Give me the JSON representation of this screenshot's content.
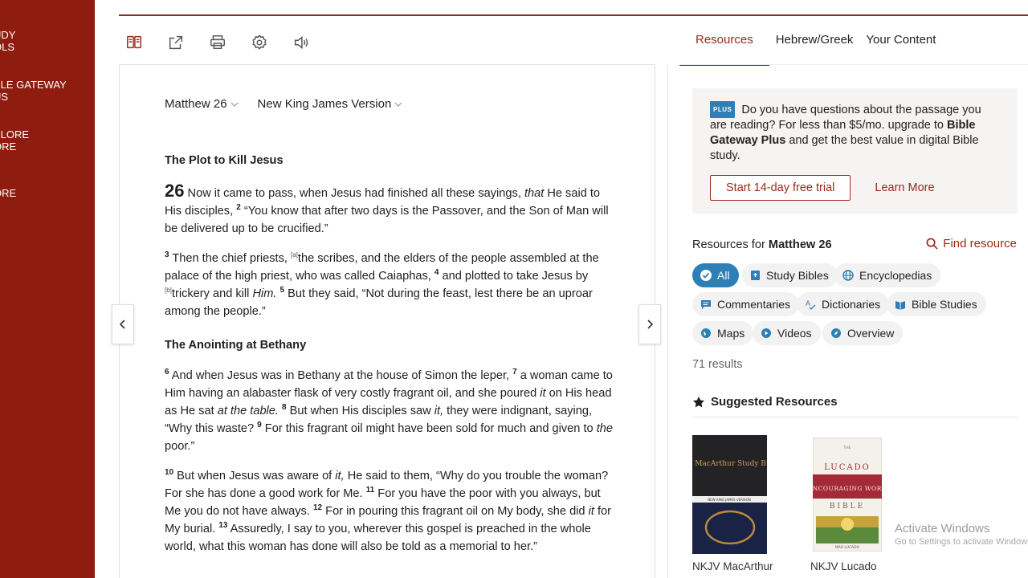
{
  "sidebar": {
    "items": [
      {
        "label": "UDY\nOLS"
      },
      {
        "label": "BLE GATEWAY\nUS"
      },
      {
        "label": "PLORE\nORE"
      },
      {
        "label": "ORE"
      }
    ]
  },
  "toolbar": {
    "icons": [
      "parallel-view-icon",
      "share-icon",
      "print-icon",
      "settings-icon",
      "audio-icon"
    ]
  },
  "tabs": [
    {
      "label": "Resources",
      "active": true
    },
    {
      "label": "Hebrew/Greek",
      "active": false
    },
    {
      "label": "Your Content",
      "active": false
    }
  ],
  "passage": {
    "reference": "Matthew 26",
    "version": "New King James Version"
  },
  "text": {
    "h1": "The Plot to Kill Jesus",
    "p1_chap": "26",
    "p1_a": " Now it came to pass, when Jesus had finished all these sayings, ",
    "p1_b_it": "that",
    "p1_c": " He said to His disciples, ",
    "p1_v2": "2",
    "p1_d": " “You know that after two days is the Passover, and the Son of Man will be delivered up to be crucified.”",
    "p2_v3": "3",
    "p2_a": " Then the chief priests, ",
    "p2_fa": "[a]",
    "p2_b": "the scribes, and the elders of the people assembled at the palace of the high priest, who was called Caiaphas, ",
    "p2_v4": "4",
    "p2_c": " and plotted to take Jesus by ",
    "p2_fb": "[b]",
    "p2_d": "trickery and kill ",
    "p2_e_it": "Him.",
    "p2_v5": "5",
    "p2_f": " But they said, “Not during the feast, lest there be an uproar among the people.”",
    "h2": "The Anointing at Bethany",
    "p3_v6": "6",
    "p3_a": " And when Jesus was in Bethany at the house of Simon the leper, ",
    "p3_v7": "7",
    "p3_b": " a woman came to Him having an alabaster flask of very costly fragrant oil, and she poured ",
    "p3_c_it": "it",
    "p3_d": " on His head as He sat ",
    "p3_e_it": "at the table.",
    "p3_v8": "8",
    "p3_f": " But when His disciples saw ",
    "p3_g_it": "it,",
    "p3_h": " they were indignant, saying, “Why this waste? ",
    "p3_v9": "9",
    "p3_i": " For this fragrant oil might have been sold for much and given to ",
    "p3_j_it": "the",
    "p3_k": " poor.”",
    "p4_v10": "10",
    "p4_a": " But when Jesus was aware of ",
    "p4_b_it": "it,",
    "p4_c": " He said to them, “Why do you trouble the woman? For she has done a good work for Me. ",
    "p4_v11": "11",
    "p4_d": " For you have the poor with you always, but Me you do not have always. ",
    "p4_v12": "12",
    "p4_e": " For in pouring this fragrant oil on My body, she did ",
    "p4_f_it": "it",
    "p4_g": " for My burial. ",
    "p4_v13": "13",
    "p4_h": " Assuredly, I say to you, wherever this gospel is preached in the whole world, what this woman has done will also be told as a memorial to her.”"
  },
  "plus": {
    "badge": "PLUS",
    "text_a": " Do you have questions about the passage you are reading? For less than $5/mo. upgrade to ",
    "text_b": "Bible Gateway Plus",
    "text_c": " and get the best value in digital Bible study.",
    "trial_button": "Start 14-day free trial",
    "learn_more": "Learn More"
  },
  "resources": {
    "title_prefix": "Resources for ",
    "title_ref": "Matthew 26",
    "find": "Find resource",
    "chips": [
      {
        "label": "All",
        "icon": "check-icon"
      },
      {
        "label": "Study Bibles",
        "icon": "bible-icon"
      },
      {
        "label": "Encyclopedias",
        "icon": "globe-icon"
      },
      {
        "label": "Commentaries",
        "icon": "comment-icon"
      },
      {
        "label": "Dictionaries",
        "icon": "spell-icon"
      },
      {
        "label": "Bible Studies",
        "icon": "bookstack-icon"
      },
      {
        "label": "Maps",
        "icon": "map-icon"
      },
      {
        "label": "Videos",
        "icon": "play-icon"
      },
      {
        "label": "Overview",
        "icon": "compass-icon"
      }
    ],
    "results": "71 results",
    "suggested": "Suggested Resources",
    "books": [
      {
        "label": "NKJV MacArthur",
        "cover_title": "The MacArthur Study Bible",
        "cover_sub": "NEW KING JAMES VERSION"
      },
      {
        "label": "NKJV Lucado",
        "cover_top": "THE",
        "cover_name": "LUCADO",
        "cover_mid": "ENCOURAGING WORD",
        "cover_bible": "BIBLE",
        "cover_author": "MAX LUCADO"
      }
    ]
  },
  "watermark": {
    "line1": "Activate Windows",
    "line2": "Go to Settings to activate Windows."
  },
  "colors": {
    "brand": "#8e1c0f",
    "accent": "#9a2a1a",
    "chip_active": "#2d7fb6"
  }
}
